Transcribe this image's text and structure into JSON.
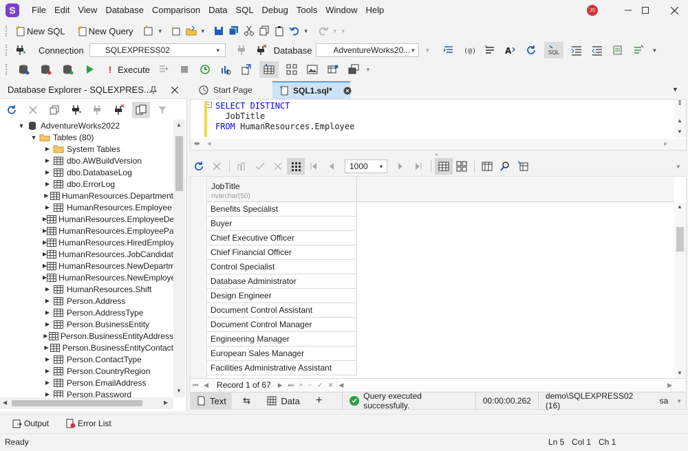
{
  "app": {
    "logo_letter": "S",
    "user_initials": "JS",
    "accent": "#7b3fd4"
  },
  "menu": [
    "File",
    "Edit",
    "View",
    "Database",
    "Comparison",
    "Data",
    "SQL",
    "Debug",
    "Tools",
    "Window",
    "Help"
  ],
  "toolbar1": {
    "new_sql": "New SQL",
    "new_query": "New Query"
  },
  "toolbar2": {
    "connection_label": "Connection",
    "connection_value": "SQLEXPRESS02",
    "database_label": "Database",
    "database_value": "AdventureWorks20..."
  },
  "toolbar3": {
    "execute": "Execute"
  },
  "explorer": {
    "title": "Database Explorer - SQLEXPRES...",
    "database": "AdventureWorks2022",
    "tables_folder": "Tables (80)",
    "items": [
      "System Tables",
      "dbo.AWBuildVersion",
      "dbo.DatabaseLog",
      "dbo.ErrorLog",
      "HumanResources.Department",
      "HumanResources.Employee",
      "HumanResources.EmployeeDep",
      "HumanResources.EmployeePay",
      "HumanResources.HiredEmploye",
      "HumanResources.JobCandidate",
      "HumanResources.NewDepartme",
      "HumanResources.NewEmployee",
      "HumanResources.Shift",
      "Person.Address",
      "Person.AddressType",
      "Person.BusinessEntity",
      "Person.BusinessEntityAddress",
      "Person.BusinessEntityContact",
      "Person.ContactType",
      "Person.CountryRegion",
      "Person.EmailAddress",
      "Person.Password"
    ]
  },
  "tabs": {
    "start": "Start Page",
    "sql1": "SQL1.sql*"
  },
  "editor": {
    "line1_kw": "SELECT DISTINCT",
    "line2": "  JobTitle",
    "line3_kw": "FROM",
    "line3_rest": " HumanResources.Employee"
  },
  "results": {
    "row_limit": "1000",
    "column_name": "JobTitle",
    "column_type": "nvarchar(50)",
    "rows": [
      "Benefits Specialist",
      "Buyer",
      "Chief Executive Officer",
      "Chief Financial Officer",
      "Control Specialist",
      "Database Administrator",
      "Design Engineer",
      "Document Control Assistant",
      "Document Control Manager",
      "Engineering Manager",
      "European Sales Manager",
      "Facilities Administrative Assistant"
    ],
    "record_nav": "Record 1 of 67"
  },
  "pane": {
    "text_tab": "Text",
    "data_tab": "Data",
    "status_message": "Query executed successfully.",
    "elapsed": "00:00:00.262",
    "server": "demo\\SQLEXPRESS02 (16)",
    "user": "sa"
  },
  "bottom": {
    "output": "Output",
    "error_list": "Error List"
  },
  "status": {
    "state": "Ready",
    "ln": "Ln 5",
    "col": "Col 1",
    "ch": "Ch 1"
  },
  "colors": {
    "keyword": "#0000ff",
    "active_tab": "#cde3f7",
    "success": "#2e9e44"
  }
}
